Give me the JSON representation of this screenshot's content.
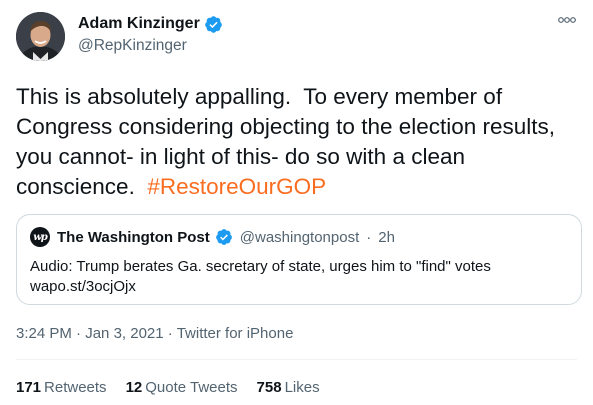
{
  "author": {
    "display_name": "Adam Kinzinger",
    "handle": "@RepKinzinger",
    "verified": true,
    "avatar_icon": "profile-photo"
  },
  "more_icon": "more-dots-icon",
  "tweet": {
    "text": "This is absolutely appalling.  To every member of Congress considering objecting to the election results, you cannot- in light of this- do so with a clean conscience.  ",
    "hashtag": "#RestoreOurGOP"
  },
  "quote": {
    "logo_text": "wp",
    "name": "The Washington Post",
    "verified": true,
    "handle": "@washingtonpost",
    "separator": "·",
    "time": "2h",
    "text": "Audio: Trump berates Ga. secretary of state, urges him to \"find\" votes wapo.st/3ocjOjx"
  },
  "meta": {
    "time": "3:24 PM",
    "separator": "·",
    "date": "Jan 3, 2021",
    "source": "Twitter for iPhone"
  },
  "stats": {
    "retweets_count": "171",
    "retweets_label": "Retweets",
    "quotes_count": "12",
    "quotes_label": "Quote Tweets",
    "likes_count": "758",
    "likes_label": "Likes"
  },
  "colors": {
    "hashtag": "#f96d21",
    "verified": "#1d9bf0",
    "secondary_text": "#536471",
    "border": "#cfd9de"
  }
}
